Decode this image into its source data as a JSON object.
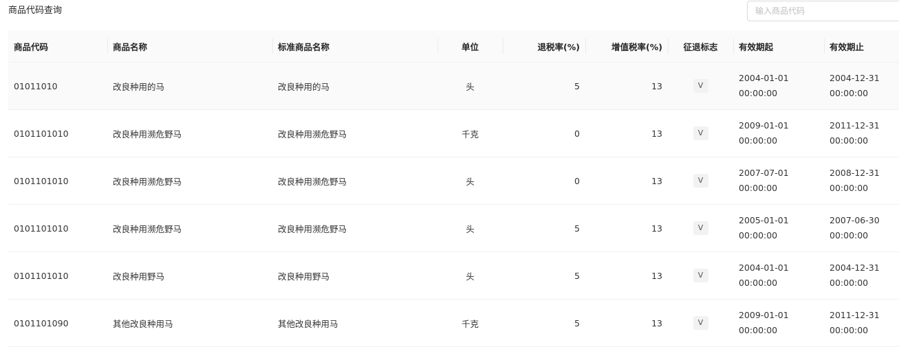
{
  "header": {
    "title": "商品代码查询"
  },
  "search": {
    "placeholder": "输入商品代码",
    "value": ""
  },
  "table": {
    "columns": [
      {
        "key": "code",
        "label": "商品代码"
      },
      {
        "key": "name",
        "label": "商品名称"
      },
      {
        "key": "std_name",
        "label": "标准商品名称"
      },
      {
        "key": "unit",
        "label": "单位"
      },
      {
        "key": "refund_rate",
        "label": "退税率(%)"
      },
      {
        "key": "vat_rate",
        "label": "增值税率(%)"
      },
      {
        "key": "flag",
        "label": "征退标志"
      },
      {
        "key": "valid_from",
        "label": "有效期起"
      },
      {
        "key": "valid_to",
        "label": "有效期止"
      }
    ],
    "rows": [
      {
        "code": "01011010",
        "name": "改良种用的马",
        "std_name": "改良种用的马",
        "unit": "头",
        "refund_rate": "5",
        "vat_rate": "13",
        "flag": "V",
        "valid_from_date": "2004-01-01",
        "valid_from_time": "00:00:00",
        "valid_to_date": "2004-12-31",
        "valid_to_time": "00:00:00"
      },
      {
        "code": "0101101010",
        "name": "改良种用濒危野马",
        "std_name": "改良种用濒危野马",
        "unit": "千克",
        "refund_rate": "0",
        "vat_rate": "13",
        "flag": "V",
        "valid_from_date": "2009-01-01",
        "valid_from_time": "00:00:00",
        "valid_to_date": "2011-12-31",
        "valid_to_time": "00:00:00"
      },
      {
        "code": "0101101010",
        "name": "改良种用濒危野马",
        "std_name": "改良种用濒危野马",
        "unit": "头",
        "refund_rate": "0",
        "vat_rate": "13",
        "flag": "V",
        "valid_from_date": "2007-07-01",
        "valid_from_time": "00:00:00",
        "valid_to_date": "2008-12-31",
        "valid_to_time": "00:00:00"
      },
      {
        "code": "0101101010",
        "name": "改良种用濒危野马",
        "std_name": "改良种用濒危野马",
        "unit": "头",
        "refund_rate": "5",
        "vat_rate": "13",
        "flag": "V",
        "valid_from_date": "2005-01-01",
        "valid_from_time": "00:00:00",
        "valid_to_date": "2007-06-30",
        "valid_to_time": "00:00:00"
      },
      {
        "code": "0101101010",
        "name": "改良种用野马",
        "std_name": "改良种用野马",
        "unit": "头",
        "refund_rate": "5",
        "vat_rate": "13",
        "flag": "V",
        "valid_from_date": "2004-01-01",
        "valid_from_time": "00:00:00",
        "valid_to_date": "2004-12-31",
        "valid_to_time": "00:00:00"
      },
      {
        "code": "0101101090",
        "name": "其他改良种用马",
        "std_name": "其他改良种用马",
        "unit": "千克",
        "refund_rate": "5",
        "vat_rate": "13",
        "flag": "V",
        "valid_from_date": "2009-01-01",
        "valid_from_time": "00:00:00",
        "valid_to_date": "2011-12-31",
        "valid_to_time": "00:00:00"
      }
    ]
  }
}
